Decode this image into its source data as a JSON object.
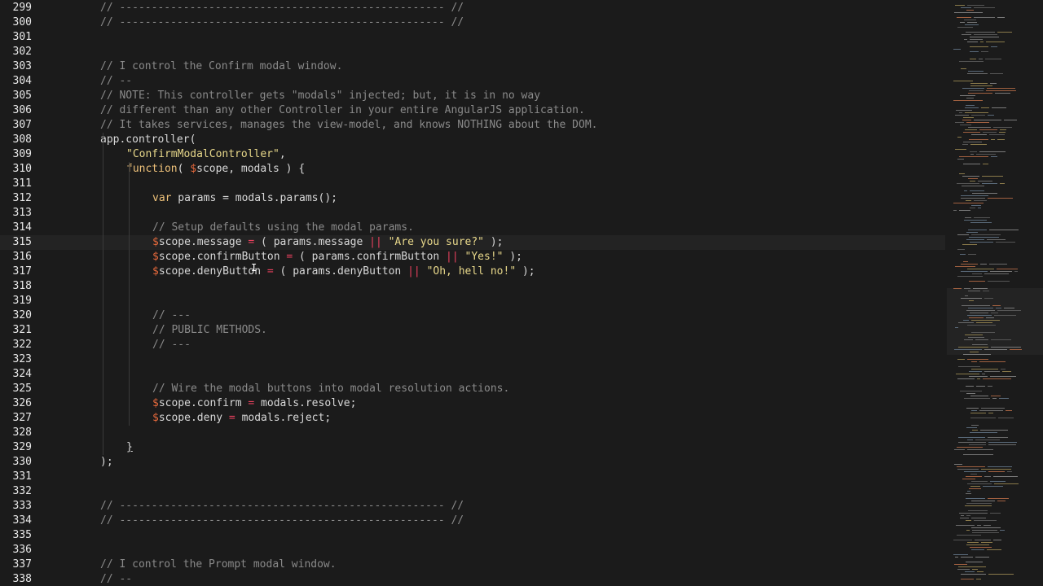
{
  "editor": {
    "language": "javascript",
    "active_line": 315,
    "lines": [
      {
        "n": "299",
        "tokens": [
          [
            "c",
            "// --------------------------------------------------- //"
          ]
        ],
        "indent": 8
      },
      {
        "n": "300",
        "tokens": [
          [
            "c",
            "// --------------------------------------------------- //"
          ]
        ],
        "indent": 8
      },
      {
        "n": "301",
        "tokens": [],
        "indent": 0
      },
      {
        "n": "302",
        "tokens": [],
        "indent": 0
      },
      {
        "n": "303",
        "tokens": [
          [
            "c",
            "// I control the Confirm modal window."
          ]
        ],
        "indent": 8
      },
      {
        "n": "304",
        "tokens": [
          [
            "c",
            "// --"
          ]
        ],
        "indent": 8
      },
      {
        "n": "305",
        "tokens": [
          [
            "c",
            "// NOTE: This controller gets \"modals\" injected; but, it is in no way"
          ]
        ],
        "indent": 8
      },
      {
        "n": "306",
        "tokens": [
          [
            "c",
            "// different than any other Controller in your entire AngularJS application."
          ]
        ],
        "indent": 8
      },
      {
        "n": "307",
        "tokens": [
          [
            "c",
            "// It takes services, manages the view-model, and knows NOTHING about the DOM."
          ]
        ],
        "indent": 8
      },
      {
        "n": "308",
        "tokens": [
          [
            "p",
            "app.controller("
          ]
        ],
        "indent": 8
      },
      {
        "n": "309",
        "tokens": [
          [
            "s",
            "\"ConfirmModalController\""
          ],
          [
            "p",
            ","
          ]
        ],
        "indent": 12
      },
      {
        "n": "310",
        "tokens": [
          [
            "k",
            "function"
          ],
          [
            "p",
            "( "
          ],
          [
            "d",
            "$"
          ],
          [
            "p",
            "scope, modals ) {"
          ]
        ],
        "indent": 12
      },
      {
        "n": "311",
        "tokens": [],
        "indent": 0
      },
      {
        "n": "312",
        "tokens": [
          [
            "k",
            "var"
          ],
          [
            "p",
            " params = modals.params();"
          ]
        ],
        "indent": 16
      },
      {
        "n": "313",
        "tokens": [],
        "indent": 0
      },
      {
        "n": "314",
        "tokens": [
          [
            "c",
            "// Setup defaults using the modal params."
          ]
        ],
        "indent": 16
      },
      {
        "n": "315",
        "tokens": [
          [
            "d",
            "$"
          ],
          [
            "p",
            "scope.message "
          ],
          [
            "o",
            "="
          ],
          [
            "p",
            " ( params.message "
          ],
          [
            "o",
            "||"
          ],
          [
            "p",
            " "
          ],
          [
            "s",
            "\"Are you sure?\""
          ],
          [
            "p",
            " );"
          ]
        ],
        "indent": 16
      },
      {
        "n": "316",
        "tokens": [
          [
            "d",
            "$"
          ],
          [
            "p",
            "scope.confirmButton "
          ],
          [
            "o",
            "="
          ],
          [
            "p",
            " ( params.confirmButton "
          ],
          [
            "o",
            "||"
          ],
          [
            "p",
            " "
          ],
          [
            "s",
            "\"Yes!\""
          ],
          [
            "p",
            " );"
          ]
        ],
        "indent": 16
      },
      {
        "n": "317",
        "tokens": [
          [
            "d",
            "$"
          ],
          [
            "p",
            "scope.denyButton "
          ],
          [
            "o",
            "="
          ],
          [
            "p",
            " ( params.denyButton "
          ],
          [
            "o",
            "||"
          ],
          [
            "p",
            " "
          ],
          [
            "s",
            "\"Oh, hell no!\""
          ],
          [
            "p",
            " );"
          ]
        ],
        "indent": 16
      },
      {
        "n": "318",
        "tokens": [],
        "indent": 0
      },
      {
        "n": "319",
        "tokens": [],
        "indent": 0
      },
      {
        "n": "320",
        "tokens": [
          [
            "c",
            "// ---"
          ]
        ],
        "indent": 16
      },
      {
        "n": "321",
        "tokens": [
          [
            "c",
            "// PUBLIC METHODS."
          ]
        ],
        "indent": 16
      },
      {
        "n": "322",
        "tokens": [
          [
            "c",
            "// ---"
          ]
        ],
        "indent": 16
      },
      {
        "n": "323",
        "tokens": [],
        "indent": 0
      },
      {
        "n": "324",
        "tokens": [],
        "indent": 0
      },
      {
        "n": "325",
        "tokens": [
          [
            "c",
            "// Wire the modal buttons into modal resolution actions."
          ]
        ],
        "indent": 16
      },
      {
        "n": "326",
        "tokens": [
          [
            "d",
            "$"
          ],
          [
            "p",
            "scope.confirm "
          ],
          [
            "o",
            "="
          ],
          [
            "p",
            " modals.resolve;"
          ]
        ],
        "indent": 16
      },
      {
        "n": "327",
        "tokens": [
          [
            "d",
            "$"
          ],
          [
            "p",
            "scope.deny "
          ],
          [
            "o",
            "="
          ],
          [
            "p",
            " modals.reject;"
          ]
        ],
        "indent": 16
      },
      {
        "n": "328",
        "tokens": [],
        "indent": 0
      },
      {
        "n": "329",
        "tokens": [
          [
            "b",
            "}"
          ]
        ],
        "indent": 12
      },
      {
        "n": "330",
        "tokens": [
          [
            "p",
            ");"
          ]
        ],
        "indent": 8
      },
      {
        "n": "331",
        "tokens": [],
        "indent": 0
      },
      {
        "n": "332",
        "tokens": [],
        "indent": 0
      },
      {
        "n": "333",
        "tokens": [
          [
            "c",
            "// --------------------------------------------------- //"
          ]
        ],
        "indent": 8
      },
      {
        "n": "334",
        "tokens": [
          [
            "c",
            "// --------------------------------------------------- //"
          ]
        ],
        "indent": 8
      },
      {
        "n": "335",
        "tokens": [],
        "indent": 0
      },
      {
        "n": "336",
        "tokens": [],
        "indent": 0
      },
      {
        "n": "337",
        "tokens": [
          [
            "c",
            "// I control the Prompt modal window."
          ]
        ],
        "indent": 8
      },
      {
        "n": "338",
        "tokens": [
          [
            "c",
            "// --"
          ]
        ],
        "indent": 8
      }
    ]
  },
  "colors": {
    "background": "#1b1b1b",
    "comment": "#8a8a8a",
    "string": "#e7d78a",
    "keyword": "#efc27a",
    "dollar": "#e86a3c",
    "operator": "#e8415e"
  },
  "cursor": {
    "glyph": "I"
  }
}
